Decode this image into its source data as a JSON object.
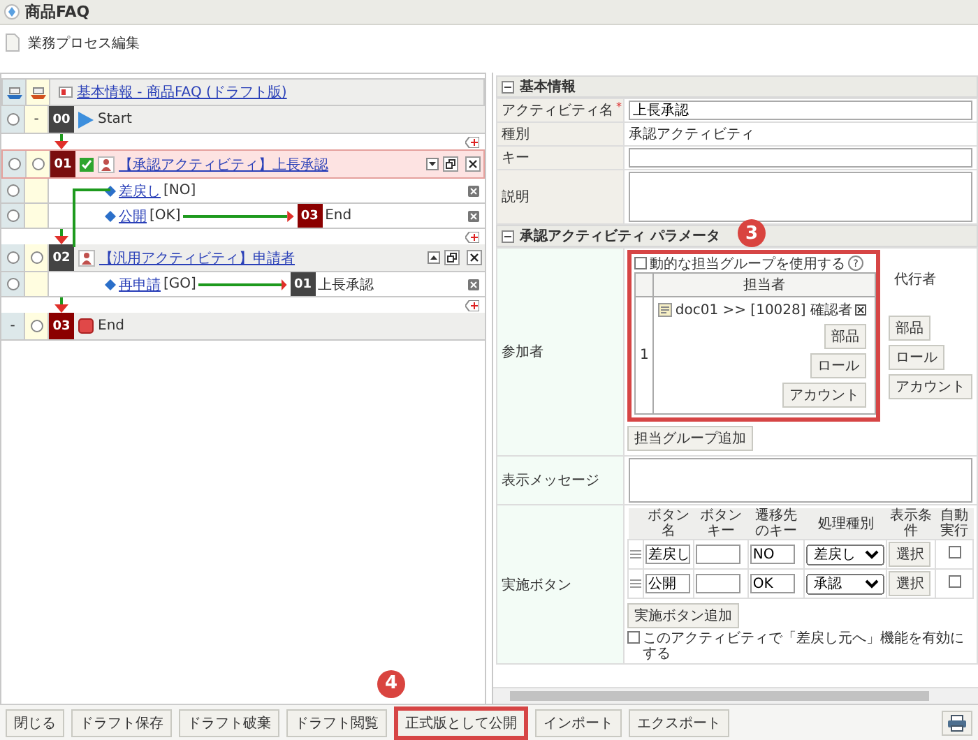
{
  "window": {
    "title": "商品FAQ"
  },
  "page_title": "業務プロセス編集",
  "flow": {
    "header_link": "基本情報 - 商品FAQ (ドラフト版)",
    "nodes": [
      {
        "kind": "start",
        "number": "00",
        "color": "#444444",
        "title": "Start",
        "col1": {
          "kind": "radio",
          "selected": false
        },
        "col2": {
          "kind": "text",
          "text": "-"
        }
      },
      {
        "kind": "activity",
        "number": "01",
        "color": "#7a0e0e",
        "title": "【承認アクティビティ】上長承認",
        "approval": true,
        "highlighted": true,
        "expanded": true,
        "col1": {
          "kind": "radio",
          "selected": false
        },
        "col2": {
          "kind": "radio",
          "selected": false
        },
        "transitions": [
          {
            "label": "差戻し",
            "key": "[NO]",
            "selected": false,
            "loop_back": true
          },
          {
            "label": "公開",
            "key": "[OK]",
            "selected": false,
            "loop_back": false,
            "target": {
              "number": "03",
              "color": "#8b0000",
              "title": "End"
            }
          }
        ]
      },
      {
        "kind": "activity",
        "number": "02",
        "color": "#444444",
        "title": "【汎用アクティビティ】申請者",
        "approval": false,
        "highlighted": false,
        "expanded": false,
        "col1": {
          "kind": "radio",
          "selected": false
        },
        "col2": {
          "kind": "radio",
          "selected": false
        },
        "transitions": [
          {
            "label": "再申請",
            "key": "[GO]",
            "selected": false,
            "loop_back": false,
            "target": {
              "number": "01",
              "color": "#444444",
              "title": "上長承認"
            }
          }
        ]
      },
      {
        "kind": "end",
        "number": "03",
        "color": "#8b0000",
        "title": "End",
        "col1": {
          "kind": "text",
          "text": "-"
        },
        "col2": {
          "kind": "radio",
          "selected": false
        }
      }
    ]
  },
  "basic_info": {
    "title": "基本情報",
    "fields": [
      {
        "kind": "input",
        "label": "アクティビティ名",
        "required_mark": "*",
        "value": "上長承認"
      },
      {
        "kind": "text",
        "label": "種別",
        "value": "承認アクティビティ"
      },
      {
        "kind": "input",
        "label": "キー"
      },
      {
        "kind": "textarea",
        "label": "説明"
      }
    ]
  },
  "parameters": {
    "title": "承認アクティビティ パラメータ",
    "participants": {
      "label": "参加者",
      "highlighted": true,
      "callout": "3",
      "dynamic_group": {
        "label": "動的な担当グループを使用する",
        "checked": false,
        "help": "?"
      },
      "columns": [
        "担当者",
        "代行者"
      ],
      "rows": [
        {
          "index": "1",
          "assignee": "doc01 >> [10028] 確認者",
          "assignee_buttons": [
            "部品",
            "ロール",
            "アカウント"
          ],
          "deputy_buttons": [
            "部品",
            "ロール",
            "アカウント"
          ]
        }
      ],
      "add_button": "担当グループ追加"
    },
    "message": {
      "label": "表示メッセージ"
    },
    "action_buttons": {
      "label": "実施ボタン",
      "columns": [
        "ボタン名",
        "ボタンキー",
        "遷移先のキー",
        "処理種別",
        "表示条件",
        "自動実行"
      ],
      "rows": [
        {
          "name": "差戻し",
          "target_key": "NO",
          "type": "差戻し",
          "condition_button": "選択",
          "auto": false
        },
        {
          "name": "公開",
          "target_key": "OK",
          "type": "承認",
          "condition_button": "選択",
          "auto": false
        }
      ],
      "add_button": "実施ボタン追加",
      "back_option": {
        "label": "このアクティビティで「差戻し元へ」機能を有効にする",
        "checked": false
      }
    }
  },
  "toolbar": {
    "buttons": [
      {
        "label": "閉じる",
        "highlighted": false
      },
      {
        "label": "ドラフト保存",
        "highlighted": false
      },
      {
        "label": "ドラフト破棄",
        "highlighted": false
      },
      {
        "label": "ドラフト閲覧",
        "highlighted": false
      },
      {
        "label": "正式版として公開",
        "highlighted": true,
        "callout": "4"
      },
      {
        "label": "インポート",
        "highlighted": false
      },
      {
        "label": "エクスポート",
        "highlighted": false
      }
    ]
  }
}
